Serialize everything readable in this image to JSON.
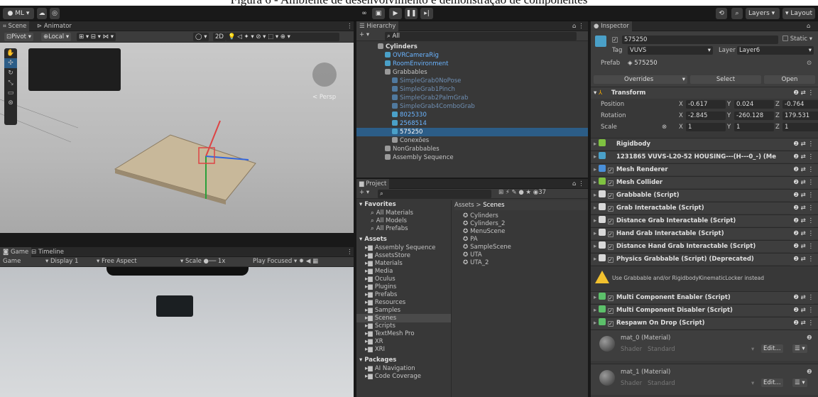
{
  "caption": "Figura 6 - Ambiente de desenvolvimento e demonstração de componentes",
  "toolbar": {
    "account": "ML",
    "layers": "Layers",
    "layout": "Layout"
  },
  "scene": {
    "tabs": [
      "Scene",
      "Animator"
    ],
    "pivot": "Pivot",
    "local": "Local",
    "mode2d": "2D",
    "persp": "Persp"
  },
  "game": {
    "tabs": [
      "Game",
      "Timeline"
    ],
    "display": "Display 1",
    "aspect": "Free Aspect",
    "scale_label": "Scale",
    "scale_value": "1x",
    "play_focused": "Play Focused",
    "label": "Game"
  },
  "hierarchy": {
    "tab": "Hierarchy",
    "search_placeholder": "All",
    "items": [
      {
        "label": "Cylinders",
        "depth": 0,
        "style": "scene"
      },
      {
        "label": "OVRCameraRig",
        "depth": 1,
        "style": "blue"
      },
      {
        "label": "RoomEnvironment",
        "depth": 1,
        "style": "blue"
      },
      {
        "label": "Grabbables",
        "depth": 1,
        "style": "normal"
      },
      {
        "label": "SimpleGrab0NoPose",
        "depth": 2,
        "style": "dim"
      },
      {
        "label": "SimpleGrab1Pinch",
        "depth": 2,
        "style": "dim"
      },
      {
        "label": "SimpleGrab2PalmGrab",
        "depth": 2,
        "style": "dim"
      },
      {
        "label": "SimpleGrab4ComboGrab",
        "depth": 2,
        "style": "dim"
      },
      {
        "label": "8025330",
        "depth": 2,
        "style": "blue"
      },
      {
        "label": "2568514",
        "depth": 2,
        "style": "blue"
      },
      {
        "label": "575250",
        "depth": 2,
        "style": "selected"
      },
      {
        "label": "Conexões",
        "depth": 2,
        "style": "normal"
      },
      {
        "label": "NonGrabbables",
        "depth": 1,
        "style": "normal"
      },
      {
        "label": "Assembly Sequence",
        "depth": 1,
        "style": "normal"
      }
    ]
  },
  "project": {
    "tab": "Project",
    "count": "37",
    "breadcrumb": [
      "Assets",
      "Scenes"
    ],
    "favorites": {
      "title": "Favorites",
      "items": [
        "All Materials",
        "All Models",
        "All Prefabs"
      ]
    },
    "assets": {
      "title": "Assets",
      "items": [
        "Assembly Sequence",
        "AssetsStore",
        "Materials",
        "Media",
        "Oculus",
        "Plugins",
        "Prefabs",
        "Resources",
        "Samples",
        "Scenes",
        "Scripts",
        "TextMesh Pro",
        "XR",
        "XRI"
      ]
    },
    "packages": {
      "title": "Packages",
      "items": [
        "AI Navigation",
        "Code Coverage"
      ]
    },
    "files": [
      "Cylinders",
      "Cylinders_2",
      "MenuScene",
      "PA",
      "SampleScene",
      "UTA",
      "UTA_2"
    ]
  },
  "inspector": {
    "tab": "Inspector",
    "name": "575250",
    "static": "Static",
    "tag_label": "Tag",
    "tag": "VUVS",
    "layer_label": "Layer",
    "layer": "Layer6",
    "prefab_label": "Prefab",
    "prefab": "575250",
    "overrides": "Overrides",
    "select": "Select",
    "open": "Open",
    "transform": {
      "title": "Transform",
      "position": {
        "label": "Position",
        "x": "-0.617",
        "y": "0.024",
        "z": "-0.764"
      },
      "rotation": {
        "label": "Rotation",
        "x": "-2.845",
        "y": "-260.128",
        "z": "179.531"
      },
      "scale": {
        "label": "Scale",
        "x": "1",
        "y": "1",
        "z": "1"
      }
    },
    "components": [
      {
        "label": "Rigidbody",
        "check": false,
        "color": "#7fc241"
      },
      {
        "label": "1231865 VUVS-L20-52 HOUSING---(H---0_-) (Me",
        "check": false,
        "color": "#4aa0c8"
      },
      {
        "label": "Mesh Renderer",
        "check": true,
        "color": "#4a8fd8"
      },
      {
        "label": "Mesh Collider",
        "check": true,
        "color": "#7fc241"
      },
      {
        "label": "Grabbable (Script)",
        "check": true,
        "color": "#d8d8d8"
      },
      {
        "label": "Grab Interactable (Script)",
        "check": true,
        "color": "#d8d8d8"
      },
      {
        "label": "Distance Grab Interactable (Script)",
        "check": true,
        "color": "#d8d8d8"
      },
      {
        "label": "Hand Grab Interactable (Script)",
        "check": true,
        "color": "#d8d8d8"
      },
      {
        "label": "Distance Hand Grab Interactable (Script)",
        "check": true,
        "color": "#d8d8d8"
      },
      {
        "label": "Physics Grabbable (Script) (Deprecated)",
        "check": true,
        "color": "#d8d8d8"
      }
    ],
    "warning": "Use Grabbable and/or RigidbodyKinematicLocker instead",
    "components2": [
      {
        "label": "Multi Component Enabler (Script)",
        "check": true,
        "color": "#5cc06a"
      },
      {
        "label": "Multi Component Disabler (Script)",
        "check": true,
        "color": "#5cc06a"
      },
      {
        "label": "Respawn On Drop (Script)",
        "check": true,
        "color": "#5cc06a"
      }
    ],
    "materials": [
      {
        "name": "mat_0 (Material)",
        "shader_label": "Shader",
        "shader": "Standard",
        "edit": "Edit..."
      },
      {
        "name": "mat_1 (Material)",
        "shader_label": "Shader",
        "shader": "Standard",
        "edit": "Edit..."
      }
    ]
  },
  "colors": {
    "accent": "#2c5d87",
    "panel": "#383838",
    "header": "#3e3e3e",
    "warning": "#f2c12e"
  }
}
